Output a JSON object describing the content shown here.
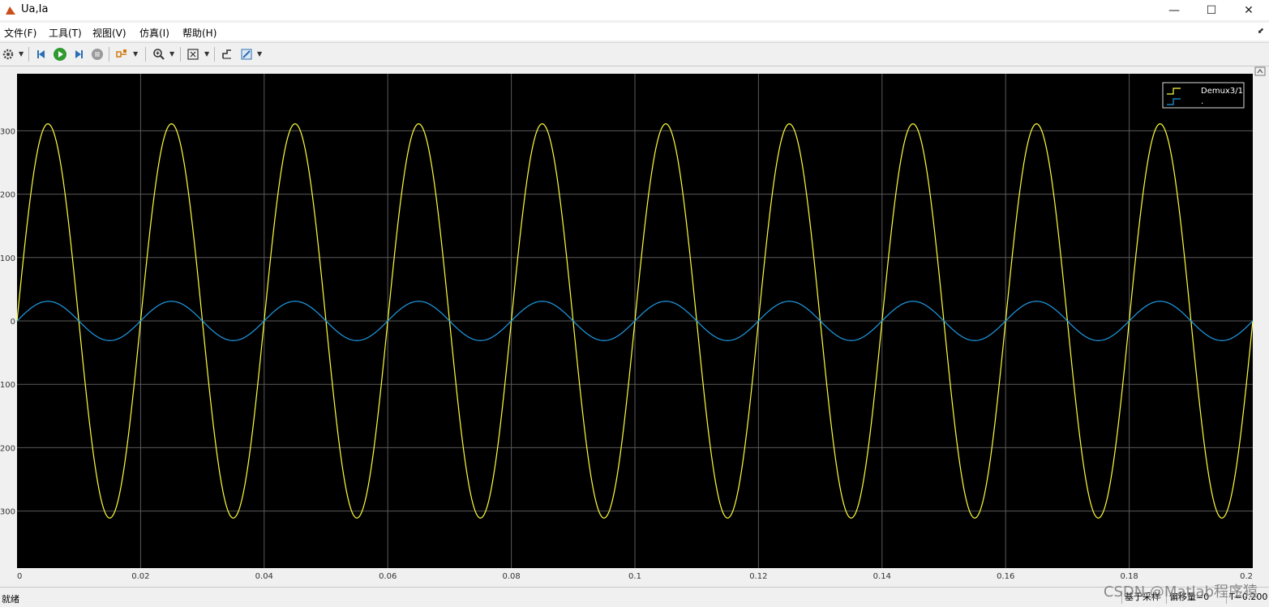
{
  "window": {
    "title": "Ua,Ia",
    "minimize_glyph": "—",
    "maximize_glyph": "☐",
    "close_glyph": "✕"
  },
  "menu": {
    "items": [
      "文件(F)",
      "工具(T)",
      "视图(V)",
      "仿真(I)",
      "帮助(H)"
    ]
  },
  "toolbar": {
    "icons": [
      "gear-icon",
      "step-back-icon",
      "run-icon",
      "step-forward-icon",
      "stop-icon",
      "highlight-icon",
      "zoom-icon",
      "fit-icon",
      "trigger-icon",
      "style-icon"
    ]
  },
  "status": {
    "left": "就绪",
    "sample_mode": "基于采样",
    "offset": "偏移量=0",
    "time": "T=0.200"
  },
  "watermark": "CSDN @Matlab程序猿",
  "colors": {
    "plot_bg": "#000000",
    "grid": "#5a5a5a",
    "axis_text": "#ffffff",
    "voltage": "#ffff3a",
    "current": "#1e9be6"
  },
  "chart_data": {
    "type": "line",
    "title": "",
    "xlabel": "",
    "ylabel": "",
    "xlim": [
      0,
      0.2
    ],
    "ylim": [
      -390,
      390
    ],
    "grid": true,
    "legend_position": "top-right",
    "x_ticks": [
      0,
      0.02,
      0.04,
      0.06,
      0.08,
      0.1,
      0.12,
      0.14,
      0.16,
      0.18,
      0.2
    ],
    "x_tick_labels": [
      "0",
      "0.02",
      "0.04",
      "0.06",
      "0.08",
      "0.1",
      "0.12",
      "0.14",
      "0.16",
      "0.18",
      "0.2"
    ],
    "y_ticks": [
      300,
      200,
      100,
      0,
      -100,
      -200,
      -300
    ],
    "y_tick_labels": [
      "300",
      "200",
      "100",
      "0",
      "100",
      "200",
      "300"
    ],
    "series": [
      {
        "name": "Demux3/1",
        "color": "#ffff3a",
        "kind": "sine",
        "amplitude": 311,
        "frequency_hz": 50,
        "phase_deg": 0,
        "x_start": 0,
        "x_end": 0.2
      },
      {
        "name": ".",
        "color": "#1e9be6",
        "kind": "sine",
        "amplitude": 31,
        "frequency_hz": 50,
        "phase_deg": 0,
        "x_start": 0,
        "x_end": 0.2
      }
    ]
  }
}
